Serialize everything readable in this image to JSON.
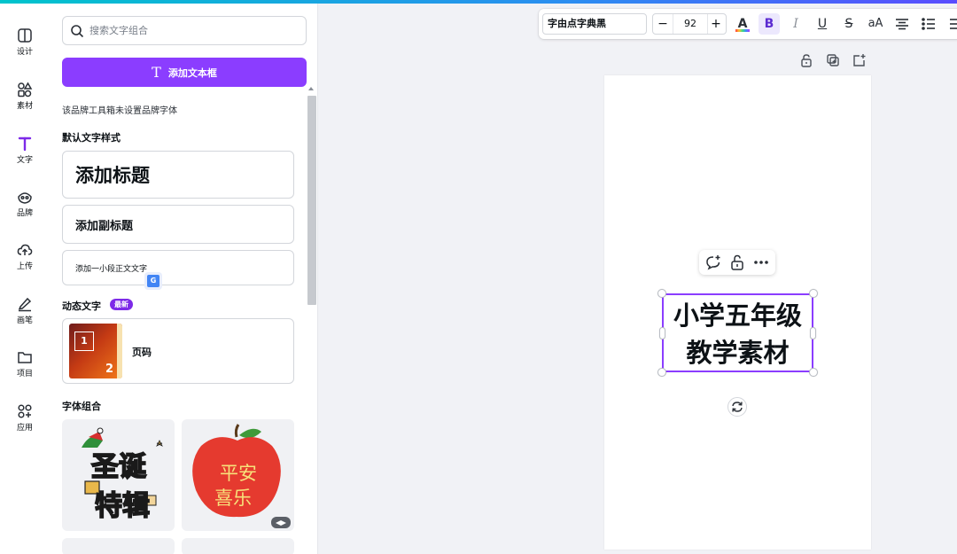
{
  "rail": {
    "items": [
      {
        "label": "设计",
        "icon": "layout-icon"
      },
      {
        "label": "素材",
        "icon": "elements-icon"
      },
      {
        "label": "文字",
        "icon": "text-icon",
        "active": true
      },
      {
        "label": "品牌",
        "icon": "brand-icon"
      },
      {
        "label": "上传",
        "icon": "upload-cloud-icon"
      },
      {
        "label": "画笔",
        "icon": "draw-pen-icon"
      },
      {
        "label": "项目",
        "icon": "folder-icon"
      },
      {
        "label": "应用",
        "icon": "apps-icon"
      }
    ]
  },
  "panel": {
    "search_placeholder": "搜索文字组合",
    "add_textbox_label": "添加文本框",
    "brand_note": "该品牌工具箱未设置品牌字体",
    "default_styles_title": "默认文字样式",
    "heading_label": "添加标题",
    "subheading_label": "添加副标题",
    "body_label": "添加一小段正文文字",
    "dynamic_title": "动态文字",
    "new_badge": "最新",
    "page_number_label": "页码",
    "page_thumb_numbers": [
      "1",
      "2"
    ],
    "font_combos_title": "字体组合",
    "combo_1_text": [
      "圣诞",
      "特辑"
    ],
    "combo_2_text": [
      "平安",
      "喜乐"
    ]
  },
  "toolbar": {
    "font_name": "字由点字典黑",
    "font_size": "92",
    "minus": "−",
    "plus": "+",
    "color_letter": "A",
    "bold": "B",
    "italic": "I",
    "underline": "U",
    "strike": "S",
    "case": "aA"
  },
  "canvas": {
    "text_line1": "小学五年级",
    "text_line2": "教学素材"
  },
  "colors": {
    "accent": "#8b3dff",
    "rail_active": "#7d2ae8",
    "canvas_bg": "#f1f2f6"
  }
}
